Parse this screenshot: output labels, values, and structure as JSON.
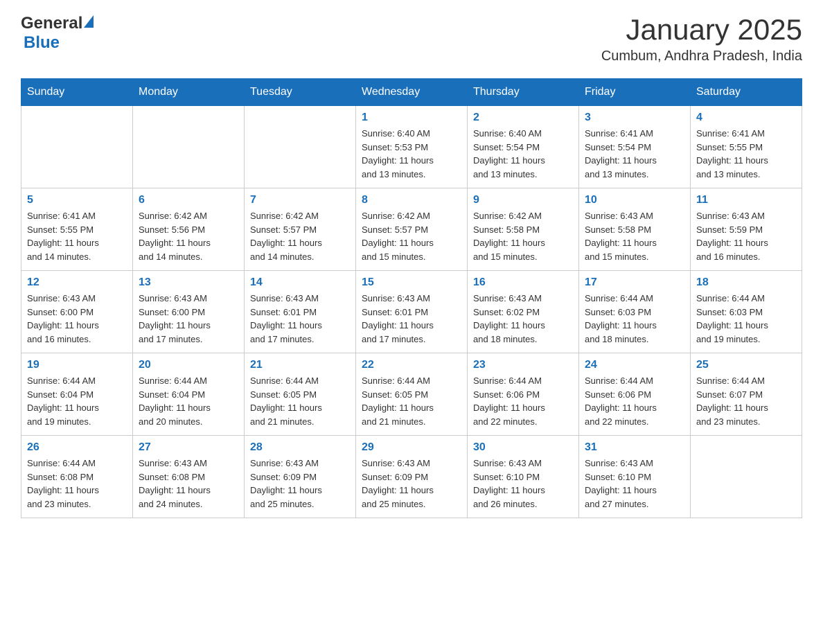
{
  "header": {
    "logo_general": "General",
    "logo_blue": "Blue",
    "month_title": "January 2025",
    "location": "Cumbum, Andhra Pradesh, India"
  },
  "days_of_week": [
    "Sunday",
    "Monday",
    "Tuesday",
    "Wednesday",
    "Thursday",
    "Friday",
    "Saturday"
  ],
  "weeks": [
    [
      {
        "day": "",
        "info": ""
      },
      {
        "day": "",
        "info": ""
      },
      {
        "day": "",
        "info": ""
      },
      {
        "day": "1",
        "info": "Sunrise: 6:40 AM\nSunset: 5:53 PM\nDaylight: 11 hours\nand 13 minutes."
      },
      {
        "day": "2",
        "info": "Sunrise: 6:40 AM\nSunset: 5:54 PM\nDaylight: 11 hours\nand 13 minutes."
      },
      {
        "day": "3",
        "info": "Sunrise: 6:41 AM\nSunset: 5:54 PM\nDaylight: 11 hours\nand 13 minutes."
      },
      {
        "day": "4",
        "info": "Sunrise: 6:41 AM\nSunset: 5:55 PM\nDaylight: 11 hours\nand 13 minutes."
      }
    ],
    [
      {
        "day": "5",
        "info": "Sunrise: 6:41 AM\nSunset: 5:55 PM\nDaylight: 11 hours\nand 14 minutes."
      },
      {
        "day": "6",
        "info": "Sunrise: 6:42 AM\nSunset: 5:56 PM\nDaylight: 11 hours\nand 14 minutes."
      },
      {
        "day": "7",
        "info": "Sunrise: 6:42 AM\nSunset: 5:57 PM\nDaylight: 11 hours\nand 14 minutes."
      },
      {
        "day": "8",
        "info": "Sunrise: 6:42 AM\nSunset: 5:57 PM\nDaylight: 11 hours\nand 15 minutes."
      },
      {
        "day": "9",
        "info": "Sunrise: 6:42 AM\nSunset: 5:58 PM\nDaylight: 11 hours\nand 15 minutes."
      },
      {
        "day": "10",
        "info": "Sunrise: 6:43 AM\nSunset: 5:58 PM\nDaylight: 11 hours\nand 15 minutes."
      },
      {
        "day": "11",
        "info": "Sunrise: 6:43 AM\nSunset: 5:59 PM\nDaylight: 11 hours\nand 16 minutes."
      }
    ],
    [
      {
        "day": "12",
        "info": "Sunrise: 6:43 AM\nSunset: 6:00 PM\nDaylight: 11 hours\nand 16 minutes."
      },
      {
        "day": "13",
        "info": "Sunrise: 6:43 AM\nSunset: 6:00 PM\nDaylight: 11 hours\nand 17 minutes."
      },
      {
        "day": "14",
        "info": "Sunrise: 6:43 AM\nSunset: 6:01 PM\nDaylight: 11 hours\nand 17 minutes."
      },
      {
        "day": "15",
        "info": "Sunrise: 6:43 AM\nSunset: 6:01 PM\nDaylight: 11 hours\nand 17 minutes."
      },
      {
        "day": "16",
        "info": "Sunrise: 6:43 AM\nSunset: 6:02 PM\nDaylight: 11 hours\nand 18 minutes."
      },
      {
        "day": "17",
        "info": "Sunrise: 6:44 AM\nSunset: 6:03 PM\nDaylight: 11 hours\nand 18 minutes."
      },
      {
        "day": "18",
        "info": "Sunrise: 6:44 AM\nSunset: 6:03 PM\nDaylight: 11 hours\nand 19 minutes."
      }
    ],
    [
      {
        "day": "19",
        "info": "Sunrise: 6:44 AM\nSunset: 6:04 PM\nDaylight: 11 hours\nand 19 minutes."
      },
      {
        "day": "20",
        "info": "Sunrise: 6:44 AM\nSunset: 6:04 PM\nDaylight: 11 hours\nand 20 minutes."
      },
      {
        "day": "21",
        "info": "Sunrise: 6:44 AM\nSunset: 6:05 PM\nDaylight: 11 hours\nand 21 minutes."
      },
      {
        "day": "22",
        "info": "Sunrise: 6:44 AM\nSunset: 6:05 PM\nDaylight: 11 hours\nand 21 minutes."
      },
      {
        "day": "23",
        "info": "Sunrise: 6:44 AM\nSunset: 6:06 PM\nDaylight: 11 hours\nand 22 minutes."
      },
      {
        "day": "24",
        "info": "Sunrise: 6:44 AM\nSunset: 6:06 PM\nDaylight: 11 hours\nand 22 minutes."
      },
      {
        "day": "25",
        "info": "Sunrise: 6:44 AM\nSunset: 6:07 PM\nDaylight: 11 hours\nand 23 minutes."
      }
    ],
    [
      {
        "day": "26",
        "info": "Sunrise: 6:44 AM\nSunset: 6:08 PM\nDaylight: 11 hours\nand 23 minutes."
      },
      {
        "day": "27",
        "info": "Sunrise: 6:43 AM\nSunset: 6:08 PM\nDaylight: 11 hours\nand 24 minutes."
      },
      {
        "day": "28",
        "info": "Sunrise: 6:43 AM\nSunset: 6:09 PM\nDaylight: 11 hours\nand 25 minutes."
      },
      {
        "day": "29",
        "info": "Sunrise: 6:43 AM\nSunset: 6:09 PM\nDaylight: 11 hours\nand 25 minutes."
      },
      {
        "day": "30",
        "info": "Sunrise: 6:43 AM\nSunset: 6:10 PM\nDaylight: 11 hours\nand 26 minutes."
      },
      {
        "day": "31",
        "info": "Sunrise: 6:43 AM\nSunset: 6:10 PM\nDaylight: 11 hours\nand 27 minutes."
      },
      {
        "day": "",
        "info": ""
      }
    ]
  ]
}
